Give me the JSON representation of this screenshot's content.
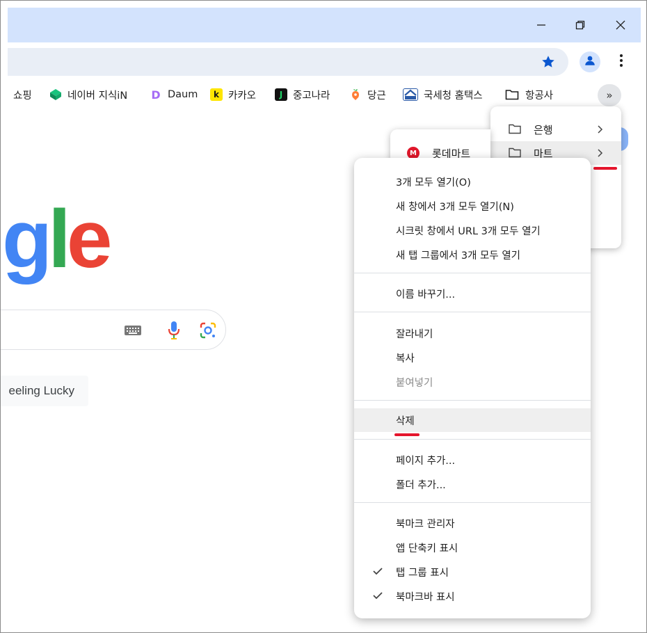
{
  "window": {
    "minimize_icon": "minimize-icon",
    "maximize_icon": "restore-icon",
    "close_icon": "close-icon"
  },
  "toolbar": {
    "bookmark_star_icon": "star-icon",
    "profile_icon": "person-icon",
    "menu_icon": "kebab-icon"
  },
  "bookmarks": {
    "items": [
      {
        "label": "쇼핑"
      },
      {
        "label": "네이버 지식iN"
      },
      {
        "label": "Daum"
      },
      {
        "label": "카카오"
      },
      {
        "label": "중고나라"
      },
      {
        "label": "당근"
      },
      {
        "label": "국세청 홈택스"
      },
      {
        "label": "항공사"
      }
    ],
    "overflow_label": "»",
    "fav": {
      "daum": "D",
      "kakao": "k",
      "joongna": "J",
      "hometax": "Hom"
    }
  },
  "page": {
    "logo": {
      "g": "g",
      "l": "l",
      "e": "e"
    },
    "lucky_label": "eeling Lucky"
  },
  "overflow_popup": {
    "items": [
      {
        "label": "은행"
      },
      {
        "label": "마트"
      }
    ]
  },
  "mart_popup": {
    "items": [
      {
        "label": "롯데마트",
        "fav": "M"
      }
    ]
  },
  "context_menu": {
    "group1": [
      {
        "label": "3개 모두 열기(O)"
      },
      {
        "label": "새 창에서 3개 모두 열기(N)"
      },
      {
        "label": "시크릿 창에서 URL 3개 모두 열기"
      },
      {
        "label": "새 탭 그룹에서 3개 모두 열기"
      }
    ],
    "group2": [
      {
        "label": "이름 바꾸기..."
      }
    ],
    "group3": [
      {
        "label": "잘라내기"
      },
      {
        "label": "복사"
      },
      {
        "label": "붙여넣기"
      }
    ],
    "group4": [
      {
        "label": "삭제"
      }
    ],
    "group5": [
      {
        "label": "페이지 추가..."
      },
      {
        "label": "폴더 추가..."
      }
    ],
    "group6": [
      {
        "label": "북마크 관리자"
      },
      {
        "label": "앱 단축키 표시"
      },
      {
        "label": "탭 그룹 표시"
      },
      {
        "label": "북마크바 표시"
      }
    ]
  },
  "colors": {
    "titlebar": "#d3e3fd",
    "star": "#0b57d0",
    "annotation": "#e5152c"
  }
}
